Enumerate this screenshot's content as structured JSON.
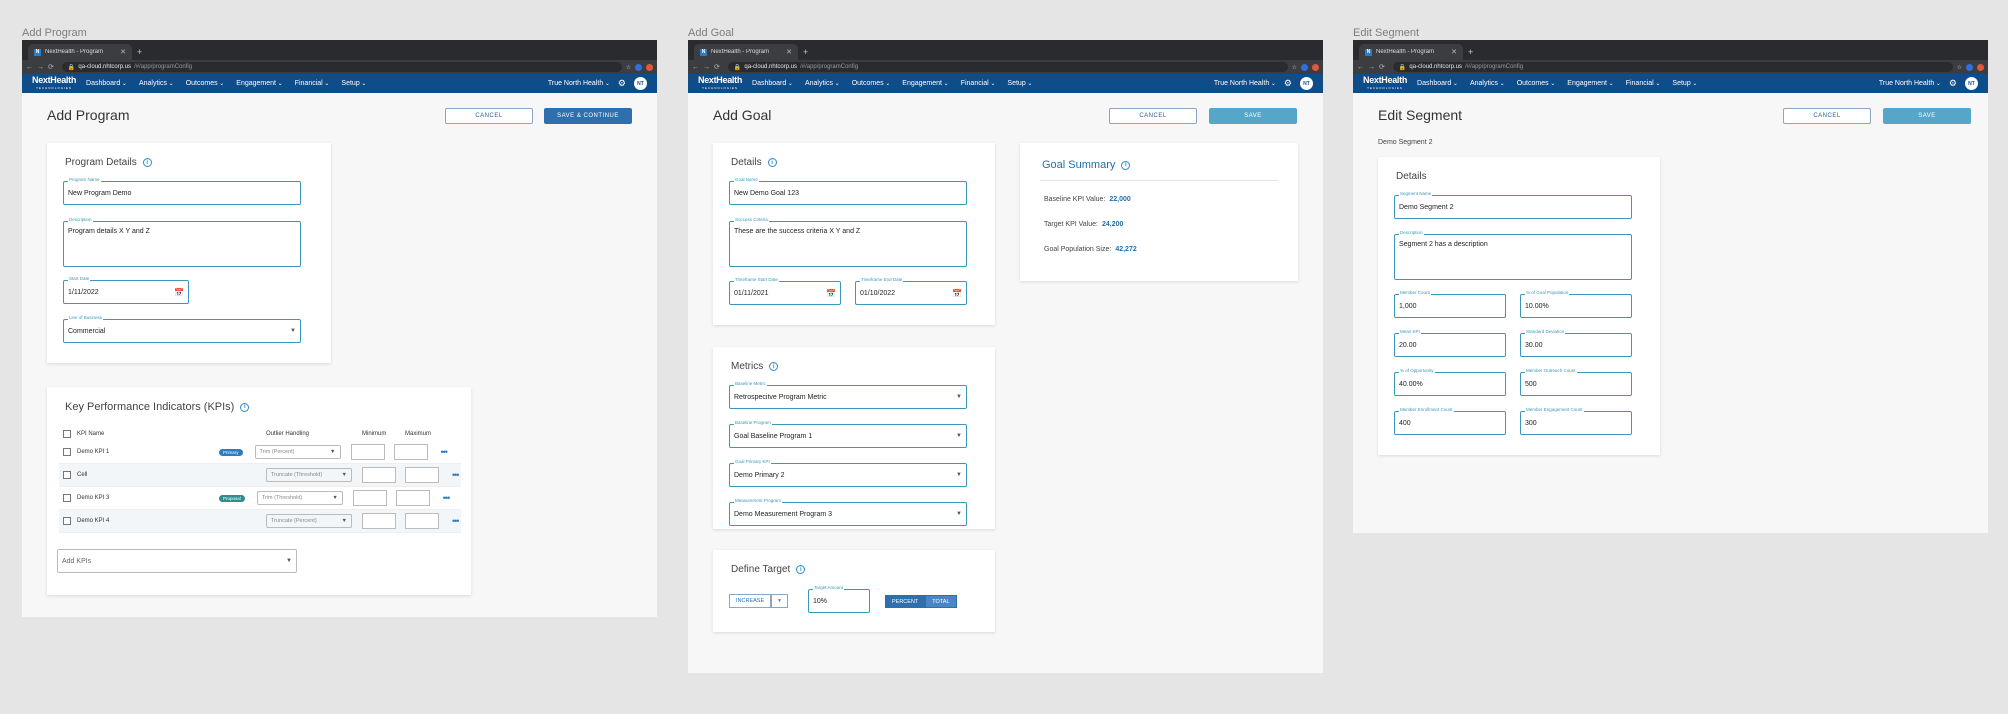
{
  "browser": {
    "tab_title": "NextHealth - Program",
    "favicon": "N",
    "url_host": "qa-cloud.nhtcorp.us",
    "url_path": "/#/app/programConfig"
  },
  "appnav": {
    "logo": "NextHealth",
    "logo_sub": "TECHNOLOGIES",
    "menu": [
      "Dashboard",
      "Analytics",
      "Outcomes",
      "Engagement",
      "Financial",
      "Setup"
    ],
    "account": "True North Health",
    "avatar": "NT"
  },
  "add_program": {
    "frame_label": "Add Program",
    "title": "Add Program",
    "cancel": "CANCEL",
    "save": "SAVE & CONTINUE",
    "details": {
      "title": "Program Details",
      "program_name_label": "Program Name",
      "program_name": "New Program Demo",
      "description_label": "Description",
      "description": "Program details X Y and Z",
      "start_date_label": "Start Date",
      "start_date": "1/11/2022",
      "lob_label": "Line of Business",
      "lob": "Commercial"
    },
    "kpis": {
      "title": "Key Performance Indicators (KPIs)",
      "headers": [
        "KPI Name",
        "Outlier Handling",
        "Minimum",
        "Maximum"
      ],
      "rows": [
        {
          "name": "Demo KPI 1",
          "badge": "Primary",
          "outlier": "Trim (Percent)"
        },
        {
          "name": "Cell",
          "badge": "",
          "outlier": "Truncate (Threshold)"
        },
        {
          "name": "Demo KPI 3",
          "badge": "Proposal",
          "outlier": "Trim (Threshold)"
        },
        {
          "name": "Demo KPI 4",
          "badge": "",
          "outlier": "Truncate (Percent)"
        }
      ],
      "add_placeholder": "Add KPIs"
    }
  },
  "add_goal": {
    "frame_label": "Add Goal",
    "title": "Add Goal",
    "cancel": "CANCEL",
    "save": "SAVE",
    "details": {
      "title": "Details",
      "goal_name_label": "Goal Name",
      "goal_name": "New Demo Goal 123",
      "success_label": "Success Criteria",
      "success": "These are the success criteria X Y and Z",
      "start_label": "Timeframe Start Date",
      "start": "01/11/2021",
      "end_label": "Timeframe End Date",
      "end": "01/10/2022"
    },
    "summary": {
      "title": "Goal Summary",
      "baseline_label": "Baseline KPI Value:",
      "baseline": "22,000",
      "target_label": "Target KPI Value:",
      "target": "24,200",
      "pop_label": "Goal Population Size:",
      "pop": "42,272"
    },
    "metrics": {
      "title": "Metrics",
      "fields": [
        {
          "label": "Baseline Metric",
          "value": "Retrospecitve Program Metric"
        },
        {
          "label": "Baseline Program",
          "value": "Goal Baseline Program 1"
        },
        {
          "label": "Goal Primary KPI",
          "value": "Demo Primary 2"
        },
        {
          "label": "Measurement Program",
          "value": "Demo Measurement Program 3"
        }
      ]
    },
    "target": {
      "title": "Define Target",
      "direction": "INCREASE",
      "amount_label": "Target Amount",
      "amount": "10%",
      "percent": "PERCENT",
      "total": "TOTAL"
    }
  },
  "edit_segment": {
    "frame_label": "Edit Segment",
    "title": "Edit Segment",
    "subtitle": "Demo Segment 2",
    "cancel": "CANCEL",
    "save": "SAVE",
    "details": {
      "title": "Details",
      "name_label": "Segment Name",
      "name": "Demo Segment 2",
      "desc_label": "Description",
      "desc": "Segment 2 has a description",
      "fields": [
        {
          "label": "Member Count",
          "value": "1,000"
        },
        {
          "label": "% of Goal Population",
          "value": "10.00%"
        },
        {
          "label": "Mean KPI",
          "value": "20.00"
        },
        {
          "label": "Standard Deviation",
          "value": "30.00"
        },
        {
          "label": "% of Opportunity",
          "value": "40.00%"
        },
        {
          "label": "Member Outreach Count",
          "value": "500"
        },
        {
          "label": "Member Enrollment Count",
          "value": "400"
        },
        {
          "label": "Member Engagement Count",
          "value": "300"
        }
      ]
    }
  }
}
